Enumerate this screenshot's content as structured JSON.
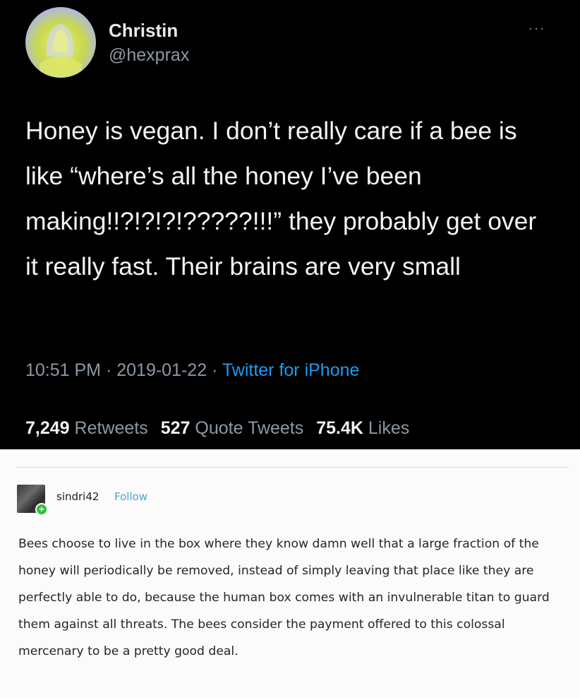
{
  "tweet": {
    "display_name": "Christin",
    "handle": "@hexprax",
    "more_icon": "more-horizontal-icon",
    "text": "Honey is vegan. I don’t really care if a bee is like “where’s all the honey I’ve been making!!?!?!?!?????!!!” they probably get over it really fast. Their brains are very small",
    "time": "10:51 PM",
    "sep1": " · ",
    "date": "2019-01-22",
    "sep2": " · ",
    "source": "Twitter for iPhone",
    "stats": {
      "retweets_count": "7,249",
      "retweets_label": "Retweets",
      "quotes_count": "527",
      "quotes_label": "Quote Tweets",
      "likes_count": "75.4K",
      "likes_label": "Likes"
    },
    "colors": {
      "background": "#000000",
      "link": "#1d9bf0",
      "muted": "#8b98a5"
    }
  },
  "reply": {
    "username": "sindri42",
    "follow_label": "Follow",
    "text": "Bees choose to live in the box where they know damn well that a large fraction of the honey will periodically be removed, instead of simply leaving that place like they are perfectly able to do, because the human box comes with an invulnerable titan to guard them against all threats. The bees consider the payment offered to this colossal mercenary to be a pretty good deal.",
    "colors": {
      "background": "#fbfbfb",
      "follow": "#47a9c8",
      "badge": "#2fbf3a"
    }
  }
}
